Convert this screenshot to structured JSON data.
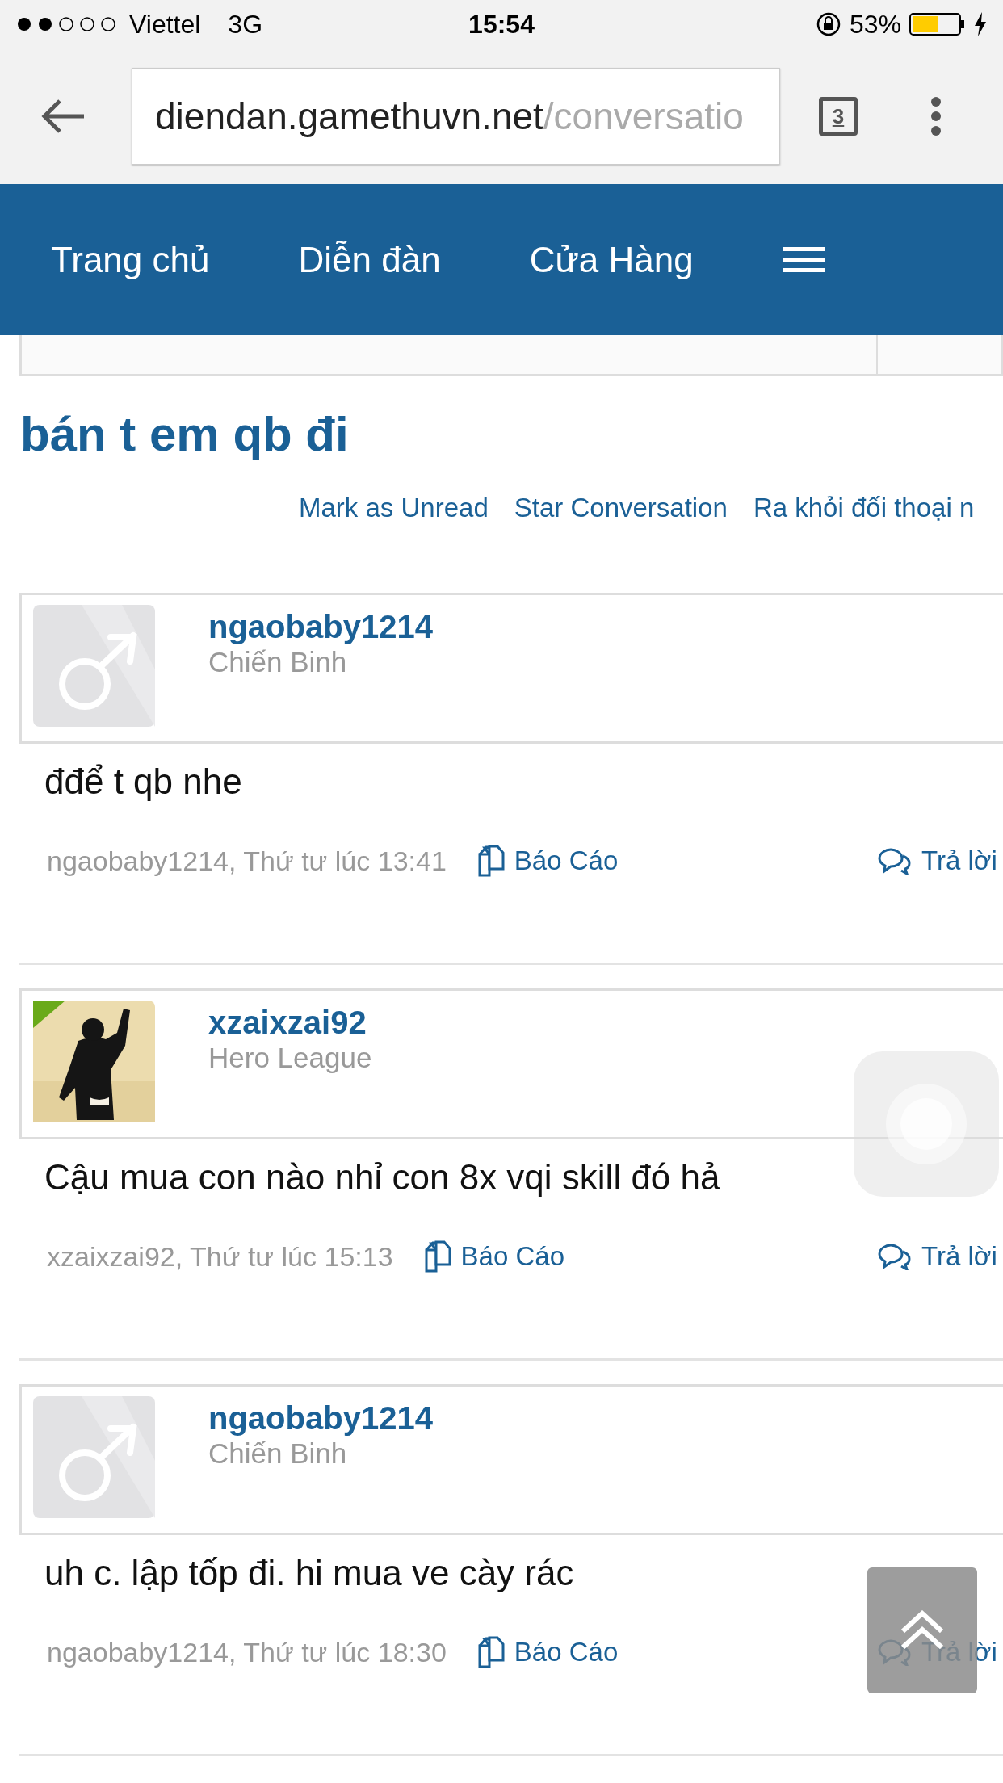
{
  "status_bar": {
    "carrier": "Viettel",
    "network": "3G",
    "time": "15:54",
    "battery": "53%"
  },
  "browser": {
    "url_host": "diendan.gamethuvn.net",
    "url_path": "/conversatio",
    "tab_count": "3"
  },
  "nav": {
    "items": [
      "Trang chủ",
      "Diễn đàn",
      "Cửa Hàng"
    ]
  },
  "title": "bán t em qb đi",
  "actions": [
    "Mark as Unread",
    "Star Conversation",
    "Ra khỏi đối thoại n"
  ],
  "messages": [
    {
      "username": "ngaobaby1214",
      "rank": "Chiến Binh",
      "avatar": {
        "kind": "default"
      },
      "text": "đđể t qb nhe",
      "meta": "ngaobaby1214, Thứ tư lúc 13:41",
      "report": "Báo Cáo",
      "reply": "Trả lời"
    },
    {
      "username": "xzaixzai92",
      "rank": "Hero League",
      "text": "Cậu mua con nào nhỉ con 8x vqi skill đó hả",
      "meta": "xzaixzai92, Thứ tư lúc 15:13",
      "report": "Báo Cáo",
      "reply": "Trả lời"
    },
    {
      "username": "ngaobaby1214",
      "rank": "Chiến Binh",
      "avatar": {
        "kind": "default"
      },
      "text": "uh c. lập tốp đi. hi mua ve cày rác",
      "meta": "ngaobaby1214, Thứ tư lúc 18:30",
      "report": "Báo Cáo",
      "reply": "Trả lời"
    }
  ]
}
